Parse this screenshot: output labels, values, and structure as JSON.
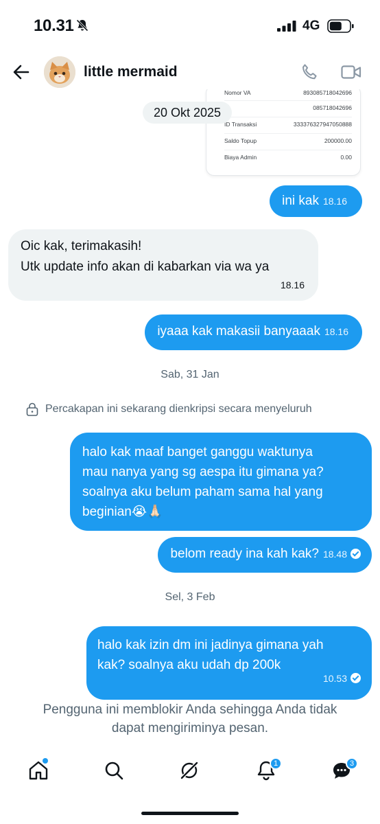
{
  "status_bar": {
    "time": "10.31",
    "network": "4G"
  },
  "header": {
    "name": "little mermaid",
    "back_icon": "arrow-left-icon",
    "call_icon": "phone-icon",
    "video_icon": "video-camera-icon"
  },
  "receipt": {
    "rows": [
      {
        "label": "Nomor VA",
        "value": "893085718042696"
      },
      {
        "label": "",
        "value": "085718042696"
      },
      {
        "label": "ID Transaksi",
        "value": "333376327947050888"
      },
      {
        "label": "Saldo Topup",
        "value": "200000.00"
      },
      {
        "label": "Biaya Admin",
        "value": "0.00"
      }
    ]
  },
  "date_chip": "20 Okt 2025",
  "messages": [
    {
      "text": "ini kak",
      "time": "18.16"
    },
    {
      "line1": "Oic kak, terimakasih!",
      "line2": "Utk update info akan di kabarkan via wa ya",
      "time": "18.16"
    },
    {
      "text": "iyaaa kak makasii banyaaak",
      "time": "18.16"
    },
    {
      "line1": "halo kak maaf banget ganggu waktunya",
      "line2": "mau nanya yang sg aespa itu gimana ya?",
      "line3": "soalnya aku belum paham sama hal yang",
      "line4": "beginian😭🙏🏻"
    },
    {
      "text": "belom ready ina kah kak?",
      "time": "18.48"
    },
    {
      "line1": "halo kak izin dm ini jadinya gimana yah",
      "line2": "kak? soalnya aku udah dp 200k",
      "time": "10.53"
    }
  ],
  "day_separators": [
    "Sab, 31 Jan",
    "Sel, 3 Feb"
  ],
  "encryption_notice": "Percakapan ini sekarang dienkripsi secara menyeluruh",
  "blocked_notice": {
    "line1": "Pengguna ini memblokir Anda sehingga Anda tidak",
    "line2": "dapat mengiriminya pesan."
  },
  "nav": {
    "items": [
      "home-icon",
      "search-icon",
      "grok-icon",
      "bell-icon",
      "messages-icon"
    ],
    "notifications_badge": "1",
    "messages_badge": "3"
  },
  "colors": {
    "accent": "#1d9bf0",
    "incoming": "#eff3f4",
    "muted": "#536471"
  }
}
